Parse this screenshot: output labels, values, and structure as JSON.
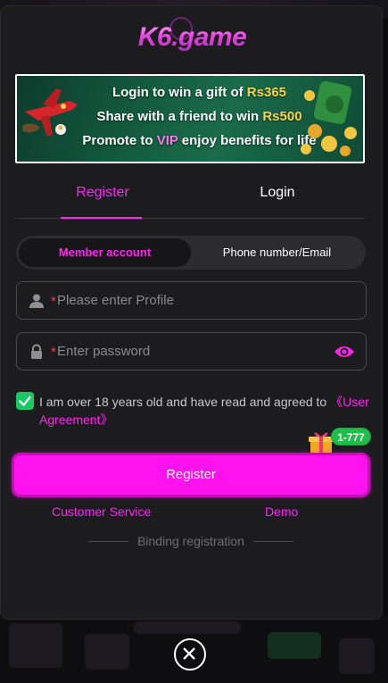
{
  "logo": {
    "text": "K6.game"
  },
  "banner": {
    "line1_pre": "Login to win a gift of ",
    "line1_amount": "Rs365",
    "line2_pre": "Share with a friend to win ",
    "line2_amount": "Rs500",
    "line3_pre": "Promote to ",
    "line3_vip": "VIP",
    "line3_post": " enjoy benefits for life"
  },
  "tabs": {
    "register": "Register",
    "login": "Login",
    "active": "register"
  },
  "segment": {
    "member": "Member account",
    "phone": "Phone number/Email",
    "active": "member"
  },
  "form": {
    "profile_placeholder": "Please enter Profile",
    "password_placeholder": "Enter password",
    "required_mark": "*"
  },
  "agreement": {
    "text": "I am over 18 years old and have read and agreed to ",
    "link": "《User Agreement》",
    "checked": true
  },
  "promo_badge": "1-777",
  "register_button": "Register",
  "links": {
    "customer_service": "Customer Service",
    "demo": "Demo"
  },
  "binding_label": "Binding registration",
  "colors": {
    "accent": "#ff24f0",
    "check": "#17c964",
    "background": "#1c1c1e"
  }
}
